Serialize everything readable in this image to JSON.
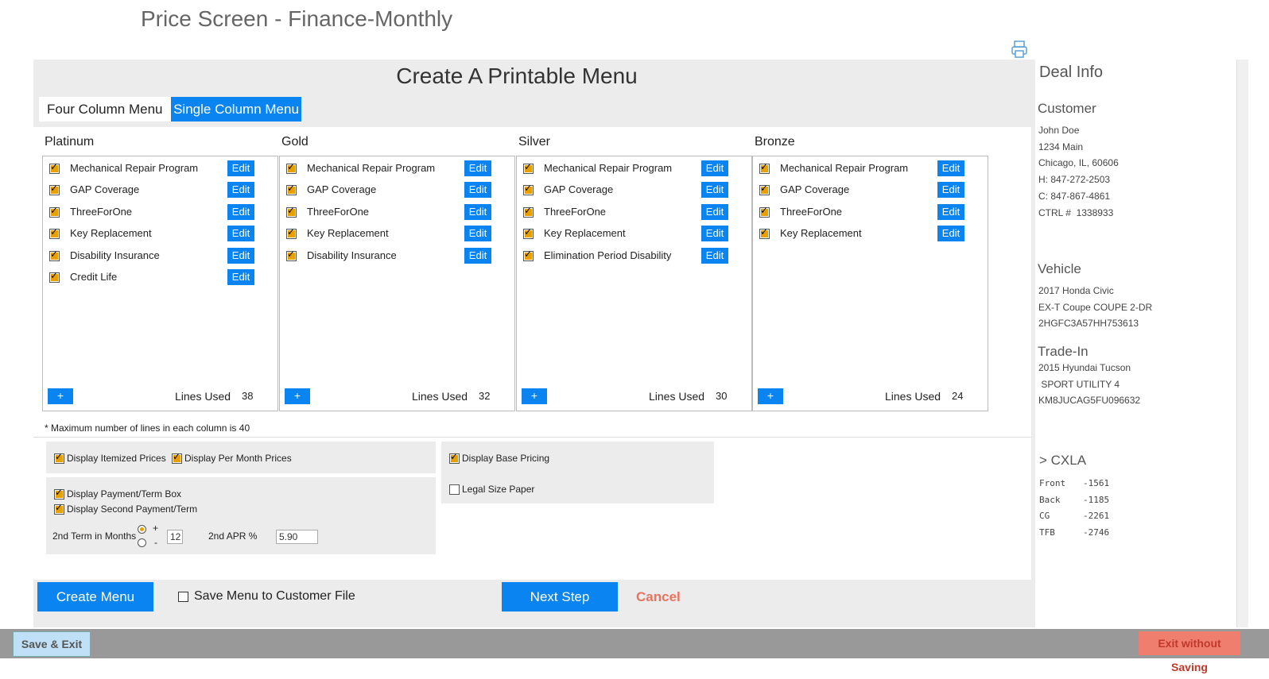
{
  "page_title": "Price Screen - Finance-Monthly",
  "heading": "Create A Printable Menu",
  "tabs": {
    "four": "Four Column Menu",
    "single": "Single Column Menu"
  },
  "columns": [
    {
      "title": "Platinum",
      "items": [
        "Mechanical Repair Program",
        "GAP Coverage",
        "ThreeForOne",
        "Key Replacement",
        "Disability Insurance",
        "Credit Life"
      ],
      "lines_used": "38"
    },
    {
      "title": "Gold",
      "items": [
        "Mechanical Repair Program",
        "GAP Coverage",
        "ThreeForOne",
        "Key Replacement",
        "Disability Insurance"
      ],
      "lines_used": "32"
    },
    {
      "title": "Silver",
      "items": [
        "Mechanical Repair Program",
        "GAP Coverage",
        "ThreeForOne",
        "Key Replacement",
        "Elimination Period Disability"
      ],
      "lines_used": "30"
    },
    {
      "title": "Bronze",
      "items": [
        "Mechanical Repair Program",
        "GAP Coverage",
        "ThreeForOne",
        "Key Replacement"
      ],
      "lines_used": "24"
    }
  ],
  "labels": {
    "edit": "Edit",
    "plus": "+",
    "lines_used": "Lines Used"
  },
  "max_note": "* Maximum number of lines in each column is 40",
  "options": {
    "itemized": "Display Itemized Prices",
    "per_month": "Display Per Month Prices",
    "payment_term": "Display Payment/Term Box",
    "second_payment": "Display Second Payment/Term",
    "second_term_label": "2nd Term in Months",
    "plus": "+",
    "minus": "-",
    "term_value": "12",
    "apr_label": "2nd APR %",
    "apr_value": "5.90",
    "base_pricing": "Display Base Pricing",
    "legal_paper": "Legal Size Paper"
  },
  "bottom": {
    "create_menu": "Create Menu",
    "save_to_file": "Save Menu to Customer File",
    "next_step": "Next Step",
    "cancel": "Cancel"
  },
  "deal": {
    "title": "Deal Info",
    "customer_h": "Customer",
    "customer": [
      "John Doe",
      "1234 Main",
      "Chicago, IL, 60606",
      "H: 847-272-2503",
      "C: 847-867-4861",
      "CTRL #  1338933"
    ],
    "vehicle_h": "Vehicle",
    "vehicle": [
      "2017 Honda Civic",
      "EX-T Coupe COUPE 2-DR",
      "2HGFC3A57HH753613"
    ],
    "tradein_h": "Trade-In",
    "tradein": [
      "2015 Hyundai Tucson",
      " SPORT UTILITY 4",
      "KM8JUCAG5FU096632"
    ],
    "cxla_h": ">  CXLA",
    "cxla": [
      {
        "k": "Front",
        "v": "-1561"
      },
      {
        "k": "Back",
        "v": "-1185"
      },
      {
        "k": "CG",
        "v": "-2261"
      },
      {
        "k": "TFB",
        "v": "-2746"
      }
    ]
  },
  "footer": {
    "save_exit": "Save & Exit",
    "exit_no_save": "Exit without Saving"
  },
  "colors": {
    "accent": "#0a84f0",
    "checkbox": "#e8a000",
    "cancel": "#e8735f"
  }
}
